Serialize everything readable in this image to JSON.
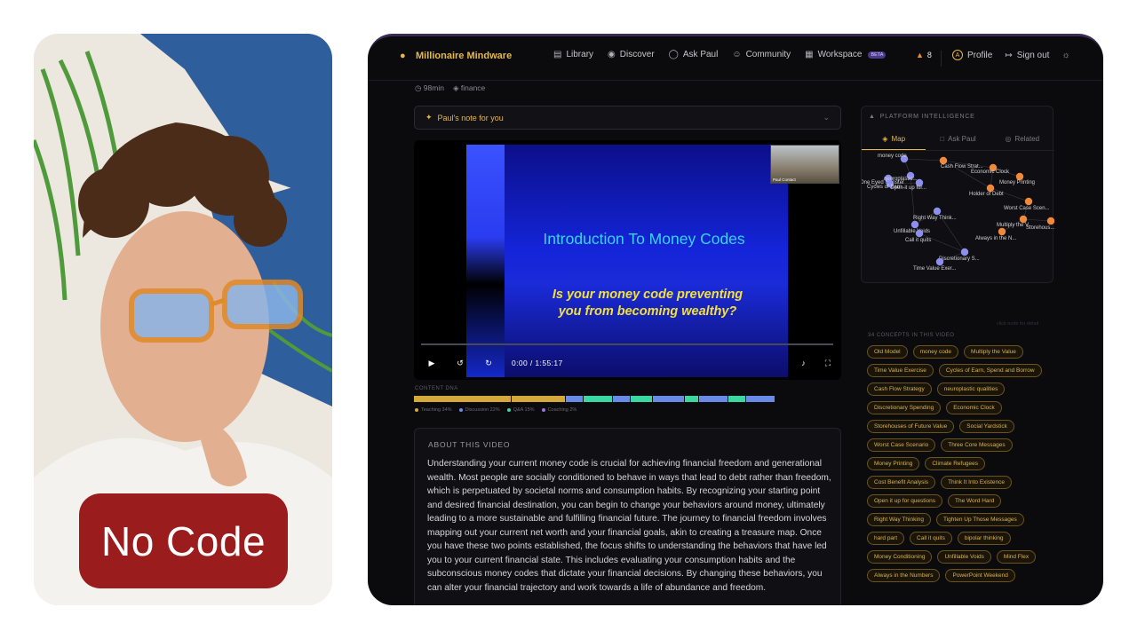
{
  "caption": "No Code",
  "nav": {
    "brand": "Millionaire Mindware",
    "links": [
      {
        "label": "Library",
        "icon": "book-icon"
      },
      {
        "label": "Discover",
        "icon": "compass-icon"
      },
      {
        "label": "Ask Paul",
        "icon": "chat-icon"
      },
      {
        "label": "Community",
        "icon": "users-icon"
      },
      {
        "label": "Workspace",
        "icon": "grid-icon",
        "badge": "BETA"
      }
    ],
    "streak": "8",
    "avatar_initial": "A",
    "profile": "Profile",
    "signout": "Sign out"
  },
  "meta": {
    "duration": "98min",
    "tag": "finance"
  },
  "note": "Paul's note for you",
  "video": {
    "slide_title": "Introduction To Money Codes",
    "slide_subtitle_1": "Is your money code preventing",
    "slide_subtitle_2": "you from becoming wealthy?",
    "pip_label": "Paul Contact",
    "time": "0:00 / 1:55:17"
  },
  "dna": {
    "label": "CONTENT DNA",
    "segments": [
      {
        "color": "#d4a83a",
        "share": 0.27
      },
      {
        "color": "#d4a83a",
        "share": 0.15
      },
      {
        "color": "#6a8ae8",
        "share": 0.05
      },
      {
        "color": "#3ad8a0",
        "share": 0.08
      },
      {
        "color": "#6a8ae8",
        "share": 0.05
      },
      {
        "color": "#3ad8a0",
        "share": 0.06
      },
      {
        "color": "#6a8ae8",
        "share": 0.09
      },
      {
        "color": "#3ad8a0",
        "share": 0.04
      },
      {
        "color": "#6a8ae8",
        "share": 0.08
      },
      {
        "color": "#3ad8a0",
        "share": 0.05
      },
      {
        "color": "#6a8ae8",
        "share": 0.08
      }
    ],
    "legend": [
      {
        "label": "Teaching 34%",
        "color": "#d4a83a"
      },
      {
        "label": "Discussion 22%",
        "color": "#6a8ae8"
      },
      {
        "label": "Q&A 15%",
        "color": "#3ad8a0"
      },
      {
        "label": "Coaching 2%",
        "color": "#a070e8"
      }
    ]
  },
  "about": {
    "heading": "ABOUT THIS VIDEO",
    "text": "Understanding your current money code is crucial for achieving financial freedom and generational wealth. Most people are socially conditioned to behave in ways that lead to debt rather than freedom, which is perpetuated by societal norms and consumption habits. By recognizing your starting point and desired financial destination, you can begin to change your behaviors around money, ultimately leading to a more sustainable and fulfilling financial future. The journey to financial freedom involves mapping out your current net worth and your financial goals, akin to creating a treasure map. Once you have these two points established, the focus shifts to understanding the behaviors that have led you to your current financial state. This includes evaluating your consumption habits and the subconscious money codes that dictate your financial decisions. By changing these behaviors, you can alter your financial trajectory and work towards a life of abundance and freedom."
  },
  "panel": {
    "heading": "PLATFORM INTELLIGENCE",
    "tabs": [
      "Map",
      "Ask Paul",
      "Related"
    ],
    "click_hint": "click node for detail",
    "graph_labels": [
      "money code",
      "One Eyed Monster",
      "Cash Flow Strat...",
      "Economic Clock",
      "Money Printing",
      "neuroplastic...",
      "Open it up for...",
      "Cycles of Earn...",
      "Holder of Debt",
      "Worst Case Scen...",
      "Right Way Think...",
      "Multiply the V...",
      "Storehous...",
      "Unfillable Voids",
      "Call it quits",
      "Always in the N...",
      "Discretionary S...",
      "Time Value Exer..."
    ],
    "concepts_heading": "34 CONCEPTS IN THIS VIDEO",
    "concepts": [
      "Old Model",
      "money code",
      "Multiply the Value",
      "Time Value Exercise",
      "Cycles of Earn, Spend and Borrow",
      "Cash Flow Strategy",
      "neuroplastic qualities",
      "Discretionary Spending",
      "Economic Clock",
      "Storehouses of Future Value",
      "Social Yardstick",
      "Worst Case Scenario",
      "Three Core Messages",
      "Money Printing",
      "Climate Refugees",
      "Cost Benefit Analysis",
      "Think It Into Existence",
      "Open it up for questions",
      "The Word Hard",
      "Right Way Thinking",
      "Tighten Up Those Messages",
      "hard part",
      "Call it quits",
      "bipolar thinking",
      "Money Conditioning",
      "Unfillable Voids",
      "Mind Flex",
      "Always in the Numbers",
      "PowerPoint Weekend"
    ]
  }
}
